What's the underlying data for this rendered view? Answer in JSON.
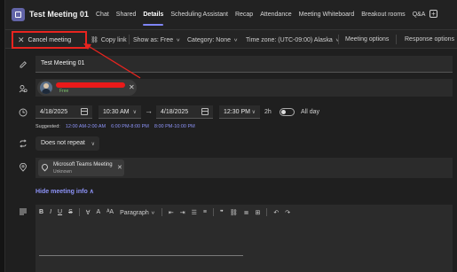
{
  "window": {
    "title": "Test Meeting 01"
  },
  "tabs": [
    {
      "label": "Chat"
    },
    {
      "label": "Shared"
    },
    {
      "label": "Details",
      "active": true
    },
    {
      "label": "Scheduling Assistant"
    },
    {
      "label": "Recap"
    },
    {
      "label": "Attendance"
    },
    {
      "label": "Meeting Whiteboard"
    },
    {
      "label": "Breakout rooms"
    },
    {
      "label": "Q&A"
    }
  ],
  "toolbar": {
    "cancel_label": "Cancel meeting",
    "copy_link_label": "Copy link",
    "show_as_label": "Show as: Free",
    "category_label": "Category: None",
    "timezone_label": "Time zone: (UTC-09:00) Alaska",
    "meeting_options_label": "Meeting options",
    "response_options_label": "Response options"
  },
  "form": {
    "title_value": "Test Meeting 01",
    "attendee": {
      "status": "Free"
    },
    "start_date": "4/18/2025",
    "start_time": "10:30 AM",
    "end_date": "4/18/2025",
    "end_time": "12:30 PM",
    "duration": "2h",
    "all_day_label": "All day",
    "all_day_on": false,
    "suggested_label": "Suggested:",
    "suggested_slots": [
      "12:00 AM-2:00 AM",
      "6:00 PM-8:00 PM",
      "8:00 PM-10:00 PM"
    ],
    "repeat_value": "Does not repeat",
    "location": {
      "name": "Microsoft Teams Meeting",
      "status": "Unknown"
    },
    "hide_info_label": "Hide meeting info"
  },
  "editor": {
    "bold": "B",
    "italic": "I",
    "underline": "U",
    "strikethrough": "S",
    "paragraph_label": "Paragraph"
  },
  "colors": {
    "accent": "#7f85f5",
    "annotation_red": "#e8241f",
    "background": "#1f1f1f"
  }
}
